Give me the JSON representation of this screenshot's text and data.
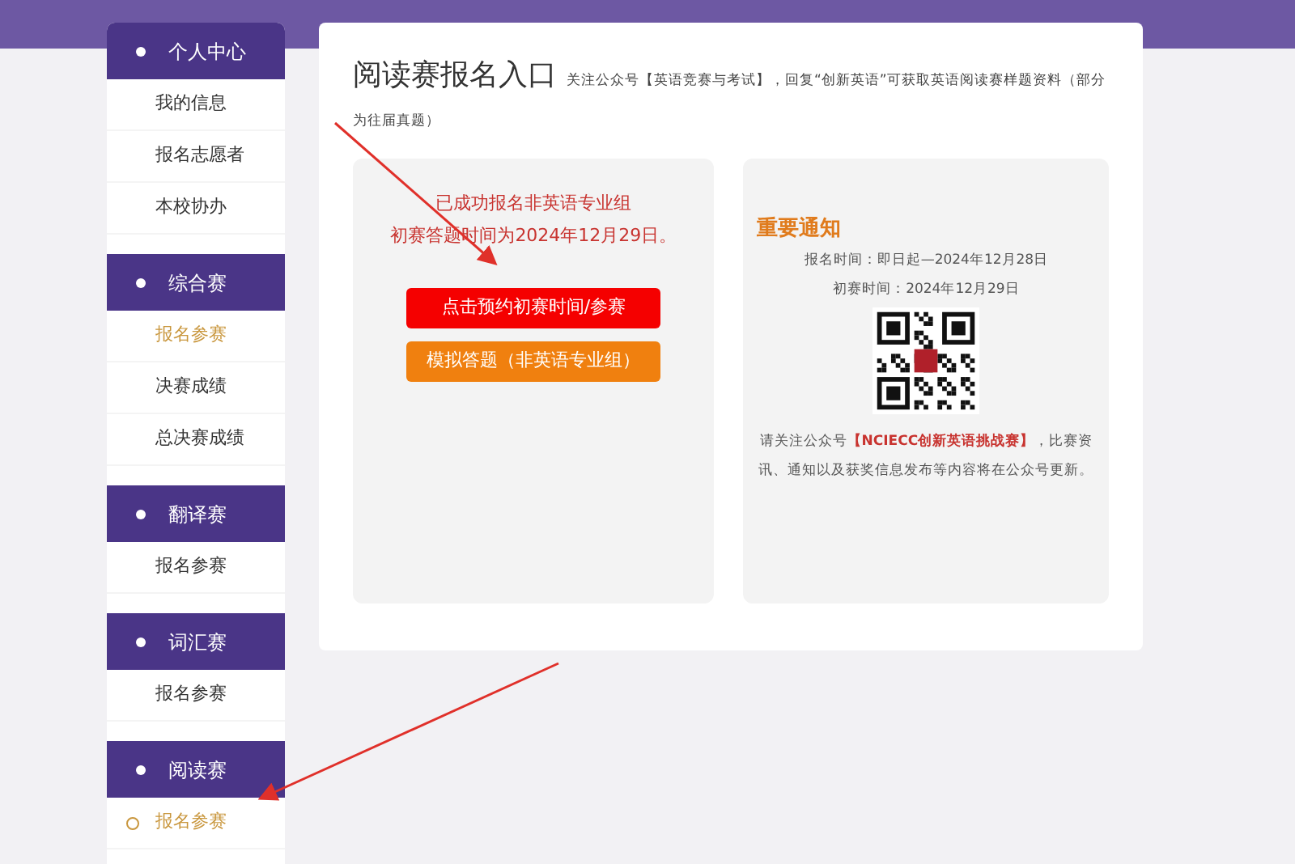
{
  "sidebar": {
    "sections": [
      {
        "title": "个人中心",
        "items": [
          {
            "label": "我的信息",
            "selected": false,
            "current": false
          },
          {
            "label": "报名志愿者",
            "selected": false,
            "current": false
          },
          {
            "label": "本校协办",
            "selected": false,
            "current": false
          }
        ]
      },
      {
        "title": "综合赛",
        "items": [
          {
            "label": "报名参赛",
            "selected": true,
            "current": false
          },
          {
            "label": "决赛成绩",
            "selected": false,
            "current": false
          },
          {
            "label": "总决赛成绩",
            "selected": false,
            "current": false
          }
        ]
      },
      {
        "title": "翻译赛",
        "items": [
          {
            "label": "报名参赛",
            "selected": false,
            "current": false
          }
        ]
      },
      {
        "title": "词汇赛",
        "items": [
          {
            "label": "报名参赛",
            "selected": false,
            "current": false
          }
        ]
      },
      {
        "title": "阅读赛",
        "items": [
          {
            "label": "报名参赛",
            "selected": true,
            "current": true
          }
        ]
      }
    ]
  },
  "main": {
    "title": "阅读赛报名入口",
    "note": "关注公众号【英语竞赛与考试】，回复“创新英语”可获取英语阅读赛样题资料（部分为往届真题）",
    "status": {
      "lines": [
        "已成功报名非英语专业组",
        "初赛答题时间为2024年12月29日。"
      ]
    },
    "buttons": [
      {
        "label": "点击预约初赛时间/参赛",
        "kind": "primary"
      },
      {
        "label": "模拟答题（非英语专业组）",
        "kind": "secondary"
      }
    ],
    "notice": {
      "title": "重要通知",
      "lines": [
        "报名时间：即日起—2024年12月28日",
        "初赛时间：2024年12月29日"
      ],
      "footer_before": "请关注公众号",
      "footer_highlight": "【NCIECC创新英语挑战赛】",
      "footer_after": "，比赛资讯、通知以及获奖信息发布等内容将在公众号更新。"
    }
  }
}
